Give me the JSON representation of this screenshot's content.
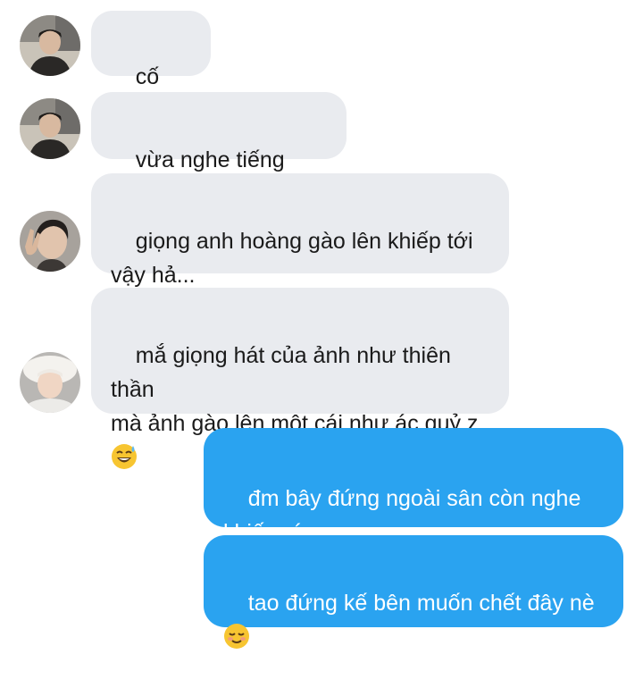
{
  "messages": [
    {
      "text": "cố nội ơi",
      "emoji": ""
    },
    {
      "text": "vừa nghe tiếng gào rú",
      "emoji": ""
    },
    {
      "text": "giọng anh hoàng gào lên khiếp tới\nvậy hả...",
      "emoji": ""
    },
    {
      "text": "mắ giọng hát của ảnh như thiên thần\nmà ảnh gào lên một cái như ác quỷ z\n",
      "emoji": "sweat-smile-emoji"
    },
    {
      "text": "đm bây đứng ngoài sân còn nghe\nkhiếp vía v",
      "emoji": ""
    },
    {
      "text": "tao đứng kế bên muốn chết đây nè\n",
      "emoji": "relieved-smile-emoji"
    }
  ],
  "colors": {
    "incoming_bubble": "#e9ebef",
    "outgoing_bubble": "#2aa3f0",
    "outgoing_text": "#ffffff",
    "incoming_text": "#1a1a1a"
  }
}
